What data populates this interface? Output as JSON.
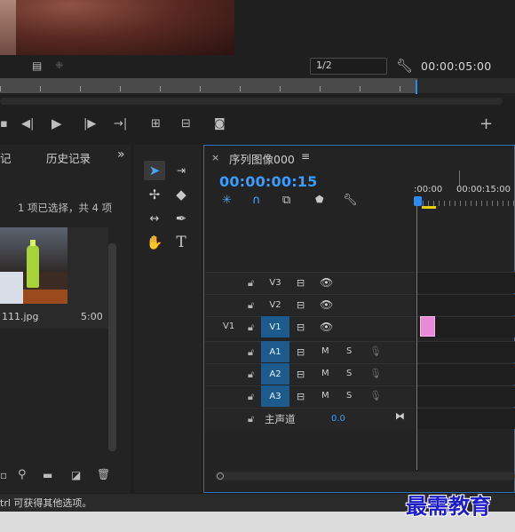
{
  "monitor": {
    "zoom": "1/2",
    "duration": "00:00:05:00"
  },
  "left_panel": {
    "tab_partial": "记",
    "tab_history": "历史记录",
    "expand": "»",
    "selection_info": "1 项已选择，共 4 项",
    "clip_name": "111.jpg",
    "clip_duration": "5:00"
  },
  "timeline": {
    "tab_close": "×",
    "tab_title": "序列图像000",
    "menu": "≡",
    "timecode": "00:00:00:15",
    "ruler": [
      ":00:00",
      "00:00:15:00"
    ],
    "tracks": [
      {
        "name": "V3",
        "src": ""
      },
      {
        "name": "V2",
        "src": ""
      },
      {
        "name": "V1",
        "src": "V1"
      },
      {
        "name": "A1",
        "m": "M",
        "s": "S"
      },
      {
        "name": "A2",
        "m": "M",
        "s": "S"
      },
      {
        "name": "A3",
        "m": "M",
        "s": "S"
      }
    ],
    "master": {
      "label": "主声道",
      "value": "0.0"
    }
  },
  "status_text": "trl 可获得其他选项。",
  "watermark": "最需教育",
  "colors": {
    "accent": "#2d8ceb",
    "clip": "#e98ad9",
    "active_track": "#1d5b8f"
  }
}
